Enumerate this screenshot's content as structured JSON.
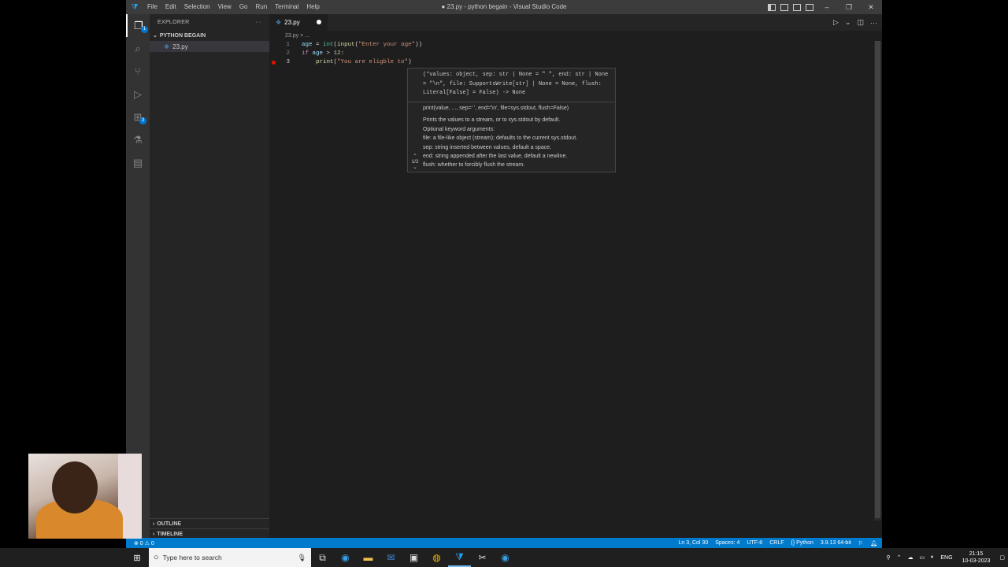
{
  "window": {
    "title": "● 23.py - python begain - Visual Studio Code",
    "menu": [
      "File",
      "Edit",
      "Selection",
      "View",
      "Go",
      "Run",
      "Terminal",
      "Help"
    ],
    "controls": [
      "–",
      "❐",
      "✕"
    ]
  },
  "activity_bar": {
    "icons": [
      "explorer-icon",
      "search-icon",
      "source-control-icon",
      "run-debug-icon",
      "extensions-icon",
      "testing-icon",
      "remote-explorer-icon"
    ],
    "badges": {
      "explorer": "1",
      "extensions": "3"
    }
  },
  "sidebar": {
    "header": "EXPLORER",
    "more": "···",
    "folder": "PYTHON BEGAIN",
    "files": [
      "23.py"
    ],
    "outline": "OUTLINE",
    "timeline": "TIMELINE"
  },
  "editor": {
    "tab": "23.py",
    "breadcrumb": "23.py > ...",
    "lines": [
      {
        "num": "1",
        "tokens": [
          [
            "var",
            "age"
          ],
          [
            "",
            " = "
          ],
          [
            "cls",
            "int"
          ],
          [
            "",
            "("
          ],
          [
            "fn",
            "input"
          ],
          [
            "",
            "("
          ],
          [
            "str",
            "\"Enter your age\""
          ],
          [
            "",
            "))"
          ]
        ]
      },
      {
        "num": "2",
        "tokens": [
          [
            "kw",
            "if"
          ],
          [
            "",
            " "
          ],
          [
            "var",
            "age"
          ],
          [
            "",
            " > "
          ],
          [
            "num",
            "12"
          ],
          [
            "",
            ":"
          ]
        ]
      },
      {
        "num": "3",
        "tokens": [
          [
            "",
            "    "
          ],
          [
            "fn",
            "print"
          ],
          [
            "",
            "("
          ],
          [
            "str",
            "\"You are eligble to\""
          ],
          [
            "",
            ")"
          ]
        ]
      }
    ],
    "hover": {
      "signature": "(*values: object, sep: str | None = \" \", end: str | None = \"\\n\", file: SupportsWrite[str] | None = None, flush: Literal[False] = False) -> None",
      "summary": "print(value, ..., sep=' ', end='\\n', file=sys.stdout, flush=False)",
      "doc": [
        "Prints the values to a stream, or to sys.stdout by default.",
        "Optional keyword arguments:",
        "file: a file-like object (stream); defaults to the current sys.stdout.",
        "sep: string inserted between values, default a space.",
        "end: string appended after the last value, default a newline.",
        "flush: whether to forcibly flush the stream."
      ],
      "pager": "1/2"
    }
  },
  "status_bar": {
    "problems": "⊗ 0 ⚠ 0",
    "position": "Ln 3, Col 30",
    "spaces": "Spaces: 4",
    "encoding": "UTF-8",
    "eol": "CRLF",
    "language": "{} Python",
    "interpreter": "3.9.13 64-bit"
  },
  "taskbar": {
    "search_placeholder": "Type here to search",
    "lang": "ENG",
    "time": "21:15",
    "date": "10-03-2023"
  }
}
